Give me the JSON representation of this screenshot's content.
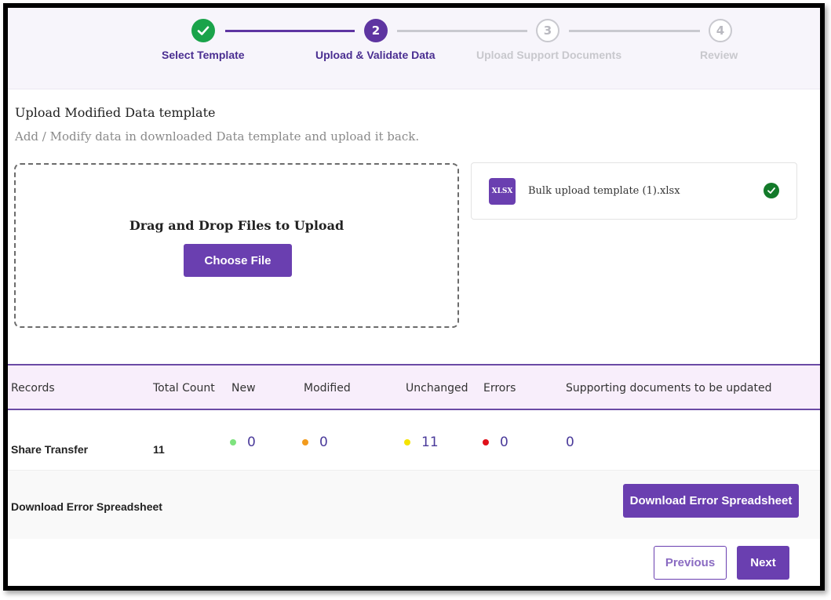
{
  "stepper": {
    "steps": [
      {
        "number": "✓",
        "label": "Select Template",
        "state": "done"
      },
      {
        "number": "2",
        "label": "Upload & Validate Data",
        "state": "active"
      },
      {
        "number": "3",
        "label": "Upload Support Documents",
        "state": "pending"
      },
      {
        "number": "4",
        "label": "Review",
        "state": "pending"
      }
    ]
  },
  "upload": {
    "title": "Upload Modified Data template",
    "subtitle": "Add / Modify data in downloaded Data template and upload it back.",
    "dropzone_text": "Drag and Drop Files to Upload",
    "choose_label": "Choose File"
  },
  "file": {
    "badge": "XLSX",
    "name": "Bulk upload template (1).xlsx",
    "status": "uploaded"
  },
  "table": {
    "headers": [
      "Records",
      "Total Count",
      "New",
      "Modified",
      "Unchanged",
      "Errors",
      "Supporting documents to be updated"
    ],
    "row": {
      "label": "Share Transfer",
      "total": "11",
      "new": "0",
      "modified": "0",
      "unchanged": "11",
      "errors": "0",
      "supporting": "0"
    }
  },
  "colors": {
    "accent": "#6a3fb0",
    "new": "#7ee37e",
    "modified": "#f29b1d",
    "unchanged": "#f5e400",
    "errors": "#e0101a",
    "done": "#1aa34a"
  },
  "download": {
    "label": "Download Error Spreadsheet",
    "button_label": "Download Error Spreadsheet"
  },
  "footer": {
    "previous_label": "Previous",
    "next_label": "Next"
  }
}
